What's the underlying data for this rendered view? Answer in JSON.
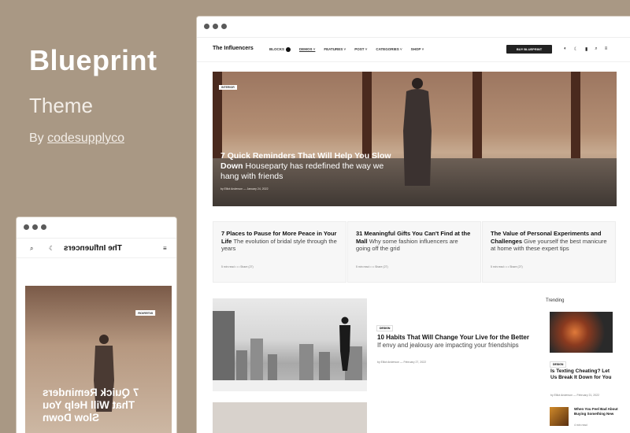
{
  "promo": {
    "title": "Blueprint",
    "subtitle": "Theme",
    "by_prefix": "By",
    "author": "codesupplyco"
  },
  "desktop": {
    "logo": "The Influencers",
    "nav": [
      "BLOCKS",
      "DEMOS ˅",
      "FEATURES ˅",
      "POST ˅",
      "CATEGORIES ˅",
      "SHOP ˅"
    ],
    "blocks_badge": "6",
    "buy_button": "BUY BLUEPRINT",
    "hero": {
      "tag": "INTERIOR",
      "title": "7 Quick Reminders That Will Help You Slow Down",
      "tail": "Houseparty has redefined the way we hang with friends",
      "meta": "by Elliot Anderson  —  January 24, 2022"
    },
    "cards": [
      {
        "title": "7 Places to Pause for More Peace in Your Life",
        "tail": "The evolution of bridal style through the years",
        "meta": "5 min read   • • •   Share (27)"
      },
      {
        "title": "31 Meaningful Gifts You Can't Find at the Mall",
        "tail": "Why some fashion influencers are going off the grid",
        "meta": "5 min read   • • •   Share (27)"
      },
      {
        "title": "The Value of Personal Experiments and Challenges",
        "tail": "Give yourself the best manicure at home with these expert tips",
        "meta": "5 min read   • • •   Share (27)"
      }
    ],
    "article": {
      "tag": "DESIGN",
      "title": "10 Habits That Will Change Your Live for the Better",
      "tail": "If envy and jealousy are impacting your friendships",
      "meta": "by Elliot Anderson  —  February 27, 2022"
    },
    "trending": {
      "label": "Trending",
      "tag": "DESIGN",
      "title": "Is Texting Cheating? Let Us Break It Down for You",
      "meta": "by Elliot Anderson  —  February 21, 2022",
      "small_title": "When You Feel Bad About Buying Something New",
      "small_meta": "4 min read"
    }
  },
  "mobile": {
    "logo": "The Influencers",
    "tag": "INTERIOR",
    "headline": "7 Quick Reminders That Will Help You Slow Down"
  }
}
